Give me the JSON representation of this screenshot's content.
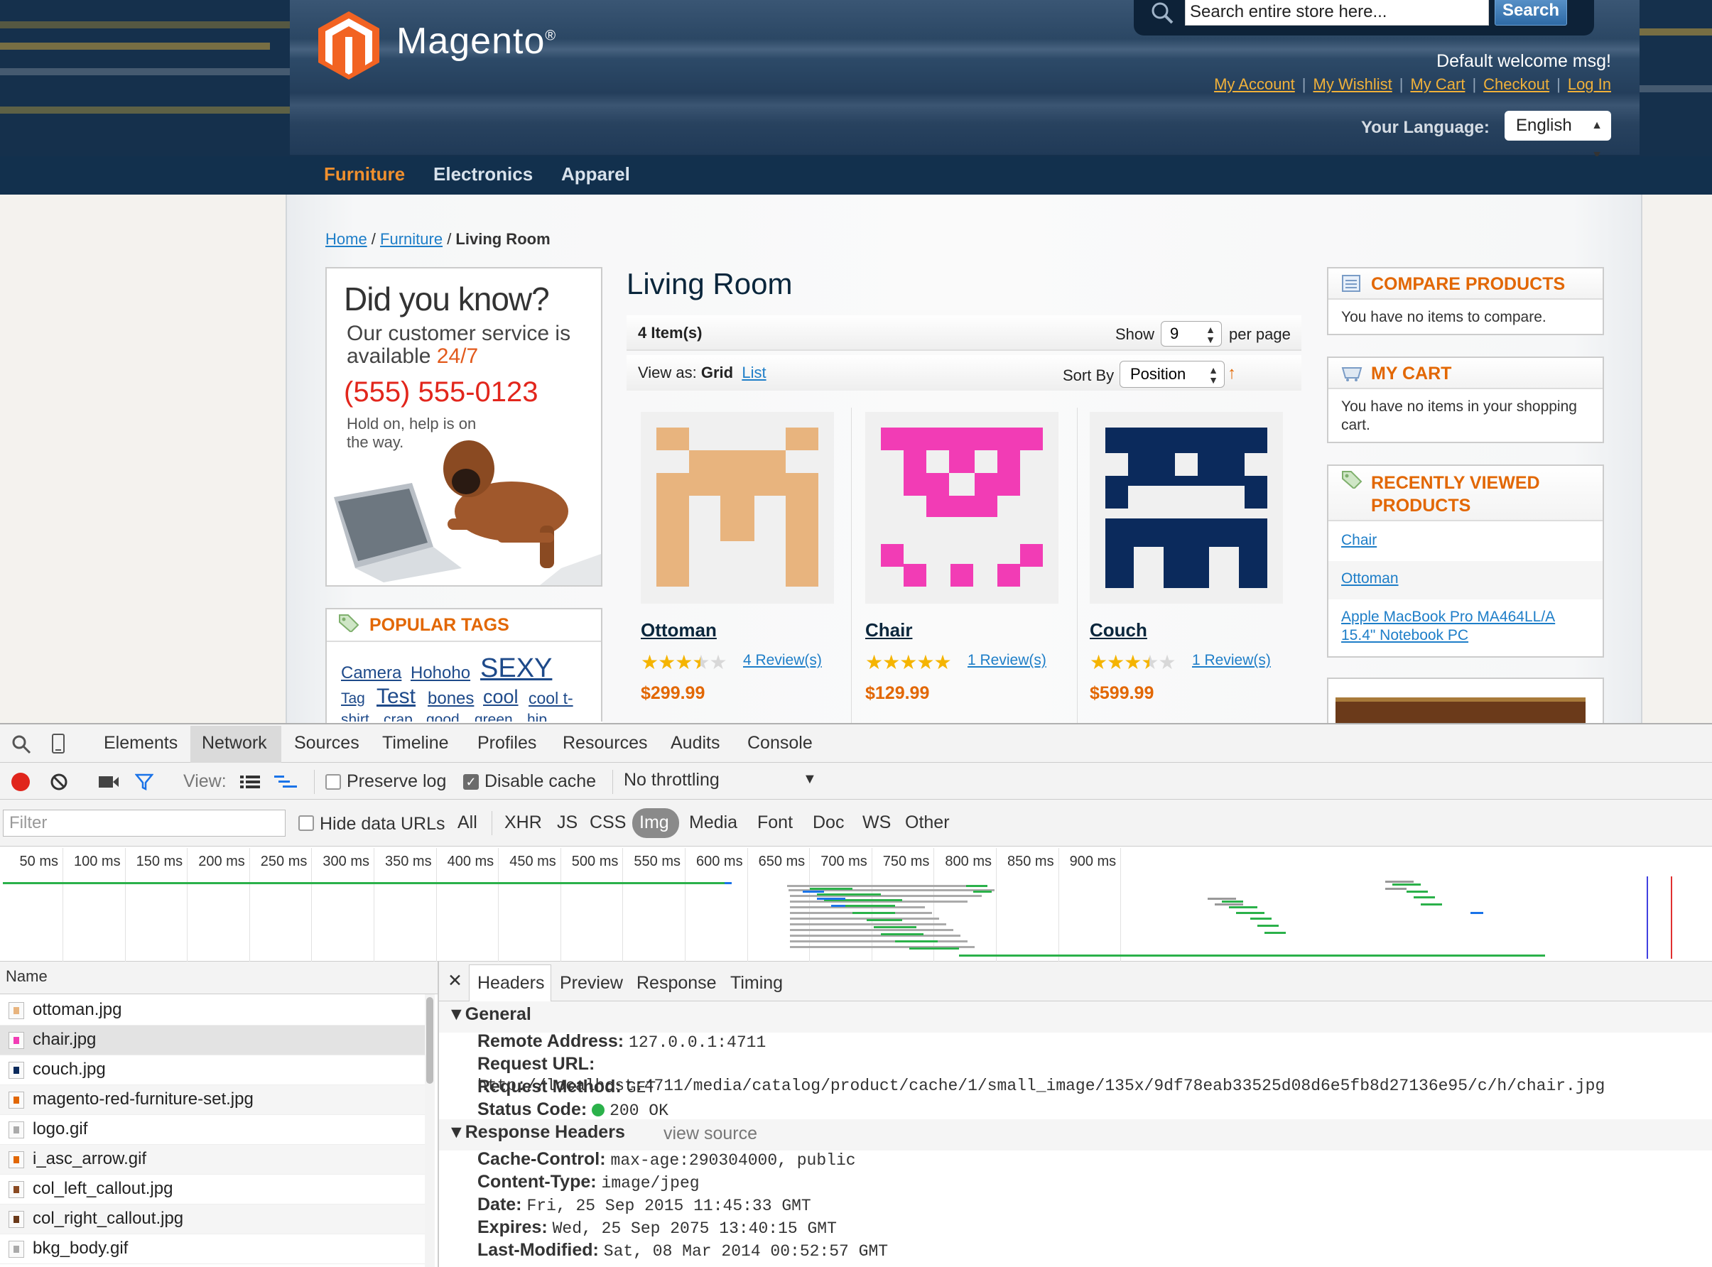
{
  "store": {
    "logo_text": "Magento",
    "logo_mark": "®",
    "search_placeholder": "Search entire store here...",
    "search_button": "Search",
    "welcome": "Default welcome msg!",
    "links": [
      "My Account",
      "My Wishlist",
      "My Cart",
      "Checkout",
      "Log In"
    ],
    "language_label": "Your Language:",
    "language_value": "English",
    "nav": [
      "Furniture",
      "Electronics",
      "Apparel"
    ],
    "nav_active": "Furniture",
    "breadcrumb": {
      "home": "Home",
      "cat": "Furniture",
      "current": "Living Room"
    },
    "callout": {
      "headline": "Did you know?",
      "line1": "Our customer service is",
      "line2": "available",
      "line2_accent": "24/7",
      "phone": "(555) 555-0123",
      "hold_on": "Hold on, help is on the way."
    },
    "popular_tags": {
      "title": "POPULAR TAGS",
      "tags": [
        "Camera",
        "Hohoho",
        "SEXY",
        "Tag",
        "Test",
        "bones",
        "cool",
        "cool t-",
        "shirt",
        "crap",
        "good",
        "green",
        "hip"
      ]
    },
    "category_title": "Living Room",
    "toolbar": {
      "items": "4 Item(s)",
      "show_label": "Show",
      "show_value": "9",
      "per_page": "per page",
      "view_as_label": "View as:",
      "view_grid": "Grid",
      "view_list": "List",
      "sort_label": "Sort By",
      "sort_value": "Position"
    },
    "products": [
      {
        "name": "Ottoman",
        "rating": 3.5,
        "reviews": "4 Review(s)",
        "price": "$299.99",
        "color": "#e8b47e"
      },
      {
        "name": "Chair",
        "rating": 5,
        "reviews": "1 Review(s)",
        "price": "$129.99",
        "color": "#f23cb5"
      },
      {
        "name": "Couch",
        "rating": 3.5,
        "reviews": "1 Review(s)",
        "price": "$599.99",
        "color": "#0b2a5c"
      }
    ],
    "compare": {
      "title": "COMPARE PRODUCTS",
      "text": "You have no items to compare."
    },
    "cart": {
      "title": "MY CART",
      "text": "You have no items in your shopping cart."
    },
    "recently_viewed": {
      "title_1": "RECENTLY VIEWED",
      "title_2": "PRODUCTS",
      "items": [
        "Chair",
        "Ottoman",
        "Apple MacBook Pro MA464LL/A 15.4\" Notebook PC"
      ]
    }
  },
  "devtools": {
    "tabs": [
      "Elements",
      "Network",
      "Sources",
      "Timeline",
      "Profiles",
      "Resources",
      "Audits",
      "Console"
    ],
    "active_tab": "Network",
    "view_label": "View:",
    "preserve_log": "Preserve log",
    "disable_cache": "Disable cache",
    "throttling": "No throttling",
    "filter_placeholder": "Filter",
    "hide_data_urls": "Hide data URLs",
    "filter_types": [
      "All",
      "XHR",
      "JS",
      "CSS",
      "Img",
      "Media",
      "Font",
      "Doc",
      "WS",
      "Other"
    ],
    "active_filter": "Img",
    "timeline_ticks": [
      "50 ms",
      "100 ms",
      "150 ms",
      "200 ms",
      "250 ms",
      "300 ms",
      "350 ms",
      "400 ms",
      "450 ms",
      "500 ms",
      "550 ms",
      "600 ms",
      "650 ms",
      "700 ms",
      "750 ms",
      "800 ms",
      "850 ms",
      "900 ms"
    ],
    "name_header": "Name",
    "requests": [
      "ottoman.jpg",
      "chair.jpg",
      "couch.jpg",
      "magento-red-furniture-set.jpg",
      "logo.gif",
      "i_asc_arrow.gif",
      "col_left_callout.jpg",
      "col_right_callout.jpg",
      "bkg_body.gif"
    ],
    "selected_request": "chair.jpg",
    "detail_tabs": [
      "Headers",
      "Preview",
      "Response",
      "Timing"
    ],
    "general": {
      "title": "General",
      "remote_address_k": "Remote Address:",
      "remote_address_v": "127.0.0.1:4711",
      "request_url_k": "Request URL:",
      "request_url_v": "http://localhost:4711/media/catalog/product/cache/1/small_image/135x/9df78eab33525d08d6e5fb8d27136e95/c/h/chair.jpg",
      "request_method_k": "Request Method:",
      "request_method_v": "GET",
      "status_k": "Status Code:",
      "status_v": "200 OK"
    },
    "response_headers": {
      "title": "Response Headers",
      "view_source": "view source",
      "cache_control_k": "Cache-Control:",
      "cache_control_v": "max-age:290304000, public",
      "content_type_k": "Content-Type:",
      "content_type_v": "image/jpeg",
      "date_k": "Date:",
      "date_v": "Fri, 25 Sep 2015 11:45:33 GMT",
      "expires_k": "Expires:",
      "expires_v": "Wed, 25 Sep 2075 13:40:15 GMT",
      "last_modified_k": "Last-Modified:",
      "last_modified_v": "Sat, 08 Mar 2014 00:52:57 GMT"
    }
  }
}
